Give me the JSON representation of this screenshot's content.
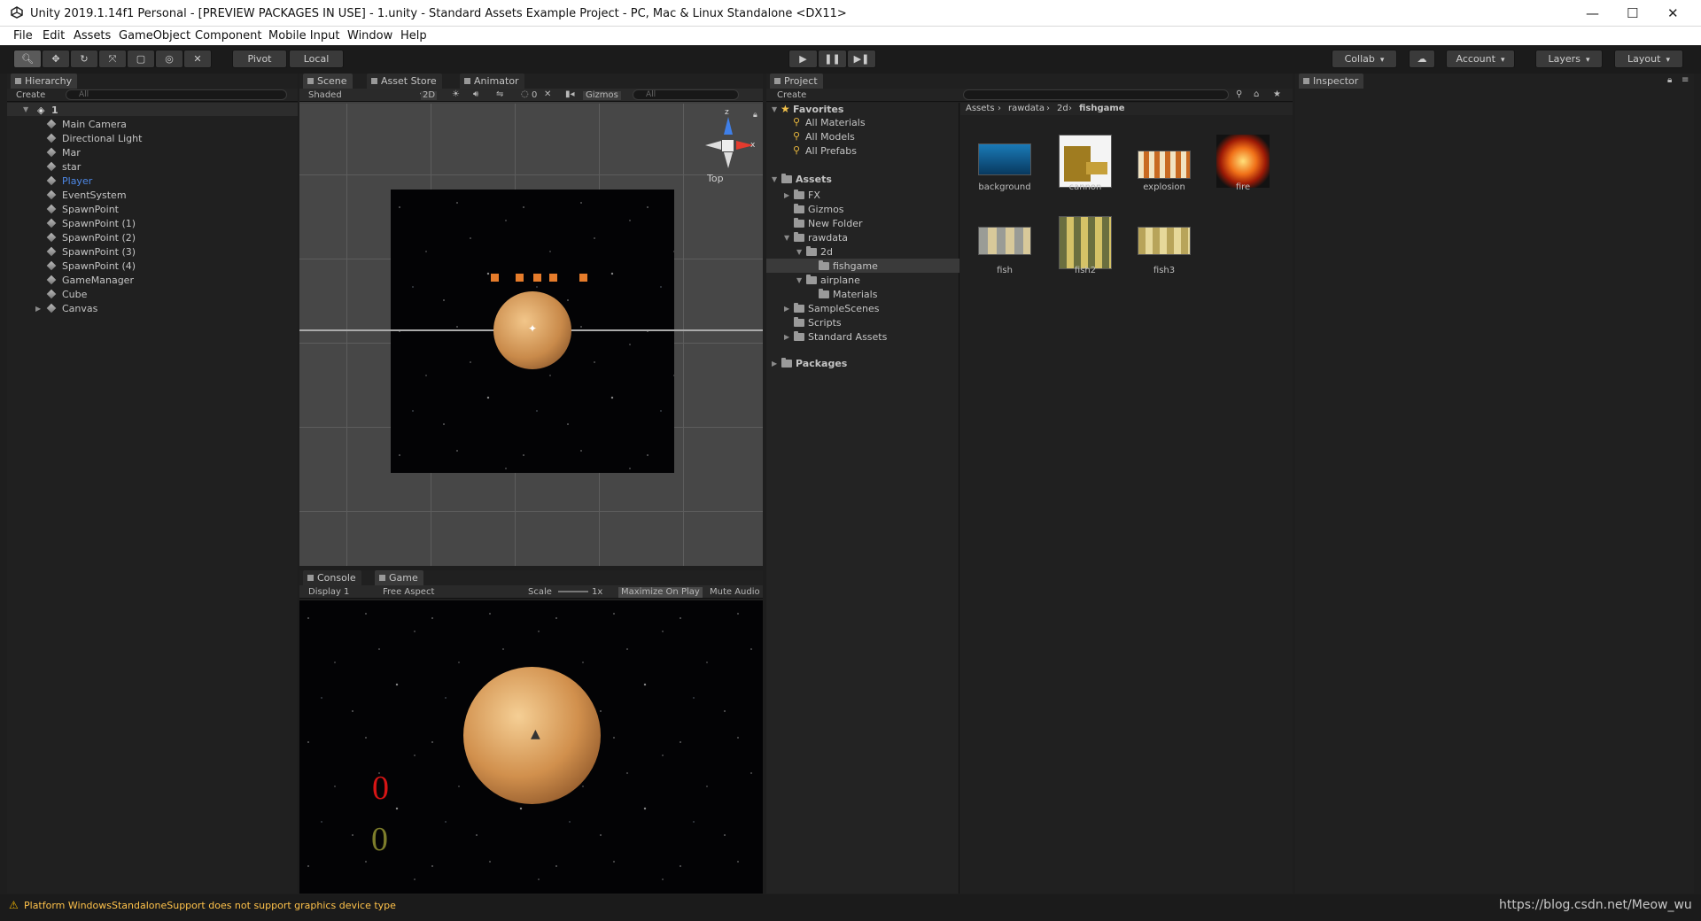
{
  "window": {
    "title": "Unity 2019.1.14f1 Personal - [PREVIEW PACKAGES IN USE] - 1.unity - Standard Assets Example Project - PC, Mac & Linux Standalone <DX11>",
    "minimize": "—",
    "maximize": "☐",
    "close": "✕"
  },
  "menu": [
    "File",
    "Edit",
    "Assets",
    "GameObject",
    "Component",
    "Mobile Input",
    "Window",
    "Help"
  ],
  "toolbar": {
    "pivot": "Pivot",
    "local": "Local",
    "collab": "Collab",
    "account": "Account",
    "layers": "Layers",
    "layout": "Layout"
  },
  "hierarchy": {
    "tab": "Hierarchy",
    "create": "Create",
    "search_placeholder": "All",
    "scene": "1",
    "items": [
      "Main Camera",
      "Directional Light",
      "Mar",
      "star",
      "Player",
      "EventSystem",
      "SpawnPoint",
      "SpawnPoint (1)",
      "SpawnPoint (2)",
      "SpawnPoint (3)",
      "SpawnPoint (4)",
      "GameManager",
      "Cube",
      "Canvas"
    ],
    "selected": "Player"
  },
  "scene": {
    "tabs": [
      "Scene",
      "Asset Store",
      "Animator"
    ],
    "shading": "Shaded",
    "mode2d": "2D",
    "gizmos": "Gizmos",
    "search_placeholder": "All",
    "gizmo_label": "Top",
    "gizmo_axis": "z",
    "counter": "0"
  },
  "game": {
    "tabs": [
      "Console",
      "Game"
    ],
    "display": "Display 1",
    "aspect": "Free Aspect",
    "scale_label": "Scale",
    "scale_value": "1x",
    "maximize": "Maximize On Play",
    "mute": "Mute Audio",
    "score_red": "0",
    "score_olive": "0"
  },
  "project": {
    "tab": "Project",
    "create": "Create",
    "favorites": {
      "title": "Favorites",
      "items": [
        "All Materials",
        "All Models",
        "All Prefabs"
      ]
    },
    "assets_title": "Assets",
    "tree": [
      {
        "label": "FX",
        "depth": 1
      },
      {
        "label": "Gizmos",
        "depth": 1
      },
      {
        "label": "New Folder",
        "depth": 1
      },
      {
        "label": "rawdata",
        "depth": 1
      },
      {
        "label": "2d",
        "depth": 2
      },
      {
        "label": "fishgame",
        "depth": 3
      },
      {
        "label": "airplane",
        "depth": 2
      },
      {
        "label": "Materials",
        "depth": 3
      },
      {
        "label": "SampleScenes",
        "depth": 1
      },
      {
        "label": "Scripts",
        "depth": 1
      },
      {
        "label": "Standard Assets",
        "depth": 1
      }
    ],
    "packages_title": "Packages",
    "breadcrumb": [
      "Assets",
      "rawdata",
      "2d",
      "fishgame"
    ],
    "assets": [
      "background",
      "cannon",
      "explosion",
      "fire",
      "fish",
      "fish2",
      "fish3"
    ]
  },
  "inspector": {
    "tab": "Inspector"
  },
  "status": {
    "message": "Platform WindowsStandaloneSupport does not support graphics device type",
    "watermark": "https://blog.csdn.net/Meow_wu"
  }
}
